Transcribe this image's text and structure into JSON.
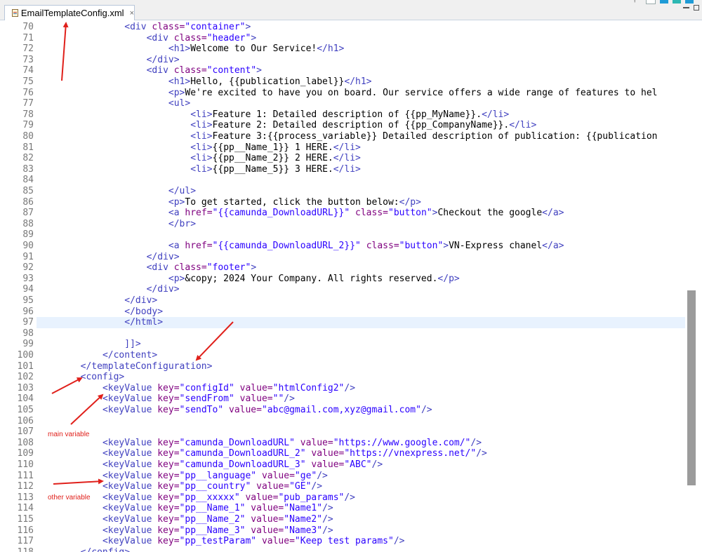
{
  "tab": {
    "title": "EmailTemplateConfig.xml",
    "close_glyph": "×",
    "icon": "xml-file-icon"
  },
  "colors": {
    "tag": "#3f3fbf",
    "attr_name": "#7f007f",
    "attr_value": "#2a00ff",
    "annotation": "#e0201b",
    "current_line": "#e8f2fe"
  },
  "annotations": {
    "main_variable": "main variable",
    "other_variable": "other variable"
  },
  "current_line": 97,
  "lines": [
    {
      "n": "70",
      "indent": 16,
      "segs": [
        [
          "t",
          "<div "
        ],
        [
          "an",
          "class="
        ],
        [
          "av",
          "\"container\""
        ],
        [
          "t",
          ">"
        ]
      ]
    },
    {
      "n": "71",
      "indent": 20,
      "segs": [
        [
          "t",
          "<div "
        ],
        [
          "an",
          "class="
        ],
        [
          "av",
          "\"header\""
        ],
        [
          "t",
          ">"
        ]
      ]
    },
    {
      "n": "72",
      "indent": 24,
      "segs": [
        [
          "t",
          "<h1>"
        ],
        [
          "txt",
          "Welcome to Our Service!"
        ],
        [
          "t",
          "</h1>"
        ]
      ]
    },
    {
      "n": "73",
      "indent": 20,
      "segs": [
        [
          "t",
          "</div>"
        ]
      ]
    },
    {
      "n": "74",
      "indent": 20,
      "segs": [
        [
          "t",
          "<div "
        ],
        [
          "an",
          "class="
        ],
        [
          "av",
          "\"content\""
        ],
        [
          "t",
          ">"
        ]
      ]
    },
    {
      "n": "75",
      "indent": 24,
      "segs": [
        [
          "t",
          "<h1>"
        ],
        [
          "txt",
          "Hello, {{publication_label}}"
        ],
        [
          "t",
          "</h1>"
        ]
      ]
    },
    {
      "n": "76",
      "indent": 24,
      "segs": [
        [
          "t",
          "<p>"
        ],
        [
          "txt",
          "We're excited to have you on board. Our service offers a wide range of features to hel"
        ]
      ]
    },
    {
      "n": "77",
      "indent": 24,
      "segs": [
        [
          "t",
          "<ul>"
        ]
      ]
    },
    {
      "n": "78",
      "indent": 28,
      "segs": [
        [
          "t",
          "<li>"
        ],
        [
          "txt",
          "Feature 1: Detailed description of {{pp_MyName}}."
        ],
        [
          "t",
          "</li>"
        ]
      ]
    },
    {
      "n": "79",
      "indent": 28,
      "segs": [
        [
          "t",
          "<li>"
        ],
        [
          "txt",
          "Feature 2: Detailed description of {{pp_CompanyName}}."
        ],
        [
          "t",
          "</li>"
        ]
      ]
    },
    {
      "n": "80",
      "indent": 28,
      "segs": [
        [
          "t",
          "<li>"
        ],
        [
          "txt",
          "Feature 3:{{process_variable}} Detailed description of publication: {{publication"
        ]
      ]
    },
    {
      "n": "81",
      "indent": 28,
      "segs": [
        [
          "t",
          "<li>"
        ],
        [
          "txt",
          "{{pp__Name_1}} 1 HERE."
        ],
        [
          "t",
          "</li>"
        ]
      ]
    },
    {
      "n": "82",
      "indent": 28,
      "segs": [
        [
          "t",
          "<li>"
        ],
        [
          "txt",
          "{{pp__Name_2}} 2 HERE."
        ],
        [
          "t",
          "</li>"
        ]
      ]
    },
    {
      "n": "83",
      "indent": 28,
      "segs": [
        [
          "t",
          "<li>"
        ],
        [
          "txt",
          "{{pp__Name_5}} 3 HERE."
        ],
        [
          "t",
          "</li>"
        ]
      ]
    },
    {
      "n": "84",
      "indent": 0,
      "segs": []
    },
    {
      "n": "85",
      "indent": 24,
      "segs": [
        [
          "t",
          "</ul>"
        ]
      ]
    },
    {
      "n": "86",
      "indent": 24,
      "segs": [
        [
          "t",
          "<p>"
        ],
        [
          "txt",
          "To get started, click the button below:"
        ],
        [
          "t",
          "</p>"
        ]
      ]
    },
    {
      "n": "87",
      "indent": 24,
      "segs": [
        [
          "t",
          "<a "
        ],
        [
          "an",
          "href="
        ],
        [
          "av",
          "\"{{camunda_DownloadURL}}\""
        ],
        [
          "t",
          " "
        ],
        [
          "an",
          "class="
        ],
        [
          "av",
          "\"button\""
        ],
        [
          "t",
          ">"
        ],
        [
          "txt",
          "Checkout the google"
        ],
        [
          "t",
          "</a>"
        ]
      ]
    },
    {
      "n": "88",
      "indent": 24,
      "segs": [
        [
          "t",
          "</br>"
        ]
      ]
    },
    {
      "n": "89",
      "indent": 0,
      "segs": []
    },
    {
      "n": "90",
      "indent": 24,
      "segs": [
        [
          "t",
          "<a "
        ],
        [
          "an",
          "href="
        ],
        [
          "av",
          "\"{{camunda_DownloadURL_2}}\""
        ],
        [
          "t",
          " "
        ],
        [
          "an",
          "class="
        ],
        [
          "av",
          "\"button\""
        ],
        [
          "t",
          ">"
        ],
        [
          "txt",
          "VN-Express chanel"
        ],
        [
          "t",
          "</a>"
        ]
      ]
    },
    {
      "n": "91",
      "indent": 20,
      "segs": [
        [
          "t",
          "</div>"
        ]
      ]
    },
    {
      "n": "92",
      "indent": 20,
      "segs": [
        [
          "t",
          "<div "
        ],
        [
          "an",
          "class="
        ],
        [
          "av",
          "\"footer\""
        ],
        [
          "t",
          ">"
        ]
      ]
    },
    {
      "n": "93",
      "indent": 24,
      "segs": [
        [
          "t",
          "<p>"
        ],
        [
          "txt",
          "&copy; 2024 Your Company. All rights reserved."
        ],
        [
          "t",
          "</p>"
        ]
      ]
    },
    {
      "n": "94",
      "indent": 20,
      "segs": [
        [
          "t",
          "</div>"
        ]
      ]
    },
    {
      "n": "95",
      "indent": 16,
      "segs": [
        [
          "t",
          "</div>"
        ]
      ]
    },
    {
      "n": "96",
      "indent": 16,
      "segs": [
        [
          "t",
          "</body>"
        ]
      ]
    },
    {
      "n": "97",
      "indent": 16,
      "segs": [
        [
          "t",
          "</html>"
        ]
      ]
    },
    {
      "n": "98",
      "indent": 0,
      "segs": []
    },
    {
      "n": "99",
      "indent": 16,
      "segs": [
        [
          "t",
          "]]>"
        ]
      ]
    },
    {
      "n": "100",
      "indent": 12,
      "segs": [
        [
          "t",
          "</content>"
        ]
      ]
    },
    {
      "n": "101",
      "indent": 8,
      "segs": [
        [
          "t",
          "</templateConfiguration>"
        ]
      ]
    },
    {
      "n": "102",
      "indent": 8,
      "segs": [
        [
          "t",
          "<config>"
        ]
      ]
    },
    {
      "n": "103",
      "indent": 12,
      "segs": [
        [
          "t",
          "<keyValue "
        ],
        [
          "an",
          "key="
        ],
        [
          "av",
          "\"configId\""
        ],
        [
          "t",
          " "
        ],
        [
          "an",
          "value="
        ],
        [
          "av",
          "\"htmlConfig2\""
        ],
        [
          "t",
          "/>"
        ]
      ]
    },
    {
      "n": "104",
      "indent": 12,
      "segs": [
        [
          "t",
          "<keyValue "
        ],
        [
          "an",
          "key="
        ],
        [
          "av",
          "\"sendFrom\""
        ],
        [
          "t",
          " "
        ],
        [
          "an",
          "value="
        ],
        [
          "av",
          "\"\""
        ],
        [
          "t",
          "/>"
        ]
      ]
    },
    {
      "n": "105",
      "indent": 12,
      "segs": [
        [
          "t",
          "<keyValue "
        ],
        [
          "an",
          "key="
        ],
        [
          "av",
          "\"sendTo\""
        ],
        [
          "t",
          " "
        ],
        [
          "an",
          "value="
        ],
        [
          "av",
          "\"abc@gmail.com,xyz@gmail.com\""
        ],
        [
          "t",
          "/>"
        ]
      ]
    },
    {
      "n": "106",
      "indent": 0,
      "segs": []
    },
    {
      "n": "107",
      "indent": 0,
      "segs": []
    },
    {
      "n": "108",
      "indent": 12,
      "segs": [
        [
          "t",
          "<keyValue "
        ],
        [
          "an",
          "key="
        ],
        [
          "av",
          "\"camunda_DownloadURL\""
        ],
        [
          "t",
          " "
        ],
        [
          "an",
          "value="
        ],
        [
          "av",
          "\"https://www.google.com/\""
        ],
        [
          "t",
          "/>"
        ]
      ]
    },
    {
      "n": "109",
      "indent": 12,
      "segs": [
        [
          "t",
          "<keyValue "
        ],
        [
          "an",
          "key="
        ],
        [
          "av",
          "\"camunda_DownloadURL_2\""
        ],
        [
          "t",
          " "
        ],
        [
          "an",
          "value="
        ],
        [
          "av",
          "\"https://vnexpress.net/\""
        ],
        [
          "t",
          "/>"
        ]
      ]
    },
    {
      "n": "110",
      "indent": 12,
      "segs": [
        [
          "t",
          "<keyValue "
        ],
        [
          "an",
          "key="
        ],
        [
          "av",
          "\"camunda_DownloadURL_3\""
        ],
        [
          "t",
          " "
        ],
        [
          "an",
          "value="
        ],
        [
          "av",
          "\"ABC\""
        ],
        [
          "t",
          "/>"
        ]
      ]
    },
    {
      "n": "111",
      "indent": 12,
      "segs": [
        [
          "t",
          "<keyValue "
        ],
        [
          "an",
          "key="
        ],
        [
          "av",
          "\"pp__language\""
        ],
        [
          "t",
          " "
        ],
        [
          "an",
          "value="
        ],
        [
          "av",
          "\"ge\""
        ],
        [
          "t",
          "/>"
        ]
      ]
    },
    {
      "n": "112",
      "indent": 12,
      "segs": [
        [
          "t",
          "<keyValue "
        ],
        [
          "an",
          "key="
        ],
        [
          "av",
          "\"pp__country\""
        ],
        [
          "t",
          " "
        ],
        [
          "an",
          "value="
        ],
        [
          "av",
          "\"GE\""
        ],
        [
          "t",
          "/>"
        ]
      ]
    },
    {
      "n": "113",
      "indent": 12,
      "segs": [
        [
          "t",
          "<keyValue "
        ],
        [
          "an",
          "key="
        ],
        [
          "av",
          "\"pp__xxxxx\""
        ],
        [
          "t",
          " "
        ],
        [
          "an",
          "value="
        ],
        [
          "av",
          "\"pub_params\""
        ],
        [
          "t",
          "/>"
        ]
      ]
    },
    {
      "n": "114",
      "indent": 12,
      "segs": [
        [
          "t",
          "<keyValue "
        ],
        [
          "an",
          "key="
        ],
        [
          "av",
          "\"pp__Name_1\""
        ],
        [
          "t",
          " "
        ],
        [
          "an",
          "value="
        ],
        [
          "av",
          "\"Name1\""
        ],
        [
          "t",
          "/>"
        ]
      ]
    },
    {
      "n": "115",
      "indent": 12,
      "segs": [
        [
          "t",
          "<keyValue "
        ],
        [
          "an",
          "key="
        ],
        [
          "av",
          "\"pp__Name_2\""
        ],
        [
          "t",
          " "
        ],
        [
          "an",
          "value="
        ],
        [
          "av",
          "\"Name2\""
        ],
        [
          "t",
          "/>"
        ]
      ]
    },
    {
      "n": "116",
      "indent": 12,
      "segs": [
        [
          "t",
          "<keyValue "
        ],
        [
          "an",
          "key="
        ],
        [
          "av",
          "\"pp__Name_3\""
        ],
        [
          "t",
          " "
        ],
        [
          "an",
          "value="
        ],
        [
          "av",
          "\"Name3\""
        ],
        [
          "t",
          "/>"
        ]
      ]
    },
    {
      "n": "117",
      "indent": 12,
      "segs": [
        [
          "t",
          "<keyValue "
        ],
        [
          "an",
          "key="
        ],
        [
          "av",
          "\"pp_testParam\""
        ],
        [
          "t",
          " "
        ],
        [
          "an",
          "value="
        ],
        [
          "av",
          "\"Keep test params\""
        ],
        [
          "t",
          "/>"
        ]
      ]
    },
    {
      "n": "118",
      "indent": 8,
      "segs": [
        [
          "t",
          "</config>"
        ]
      ]
    }
  ]
}
